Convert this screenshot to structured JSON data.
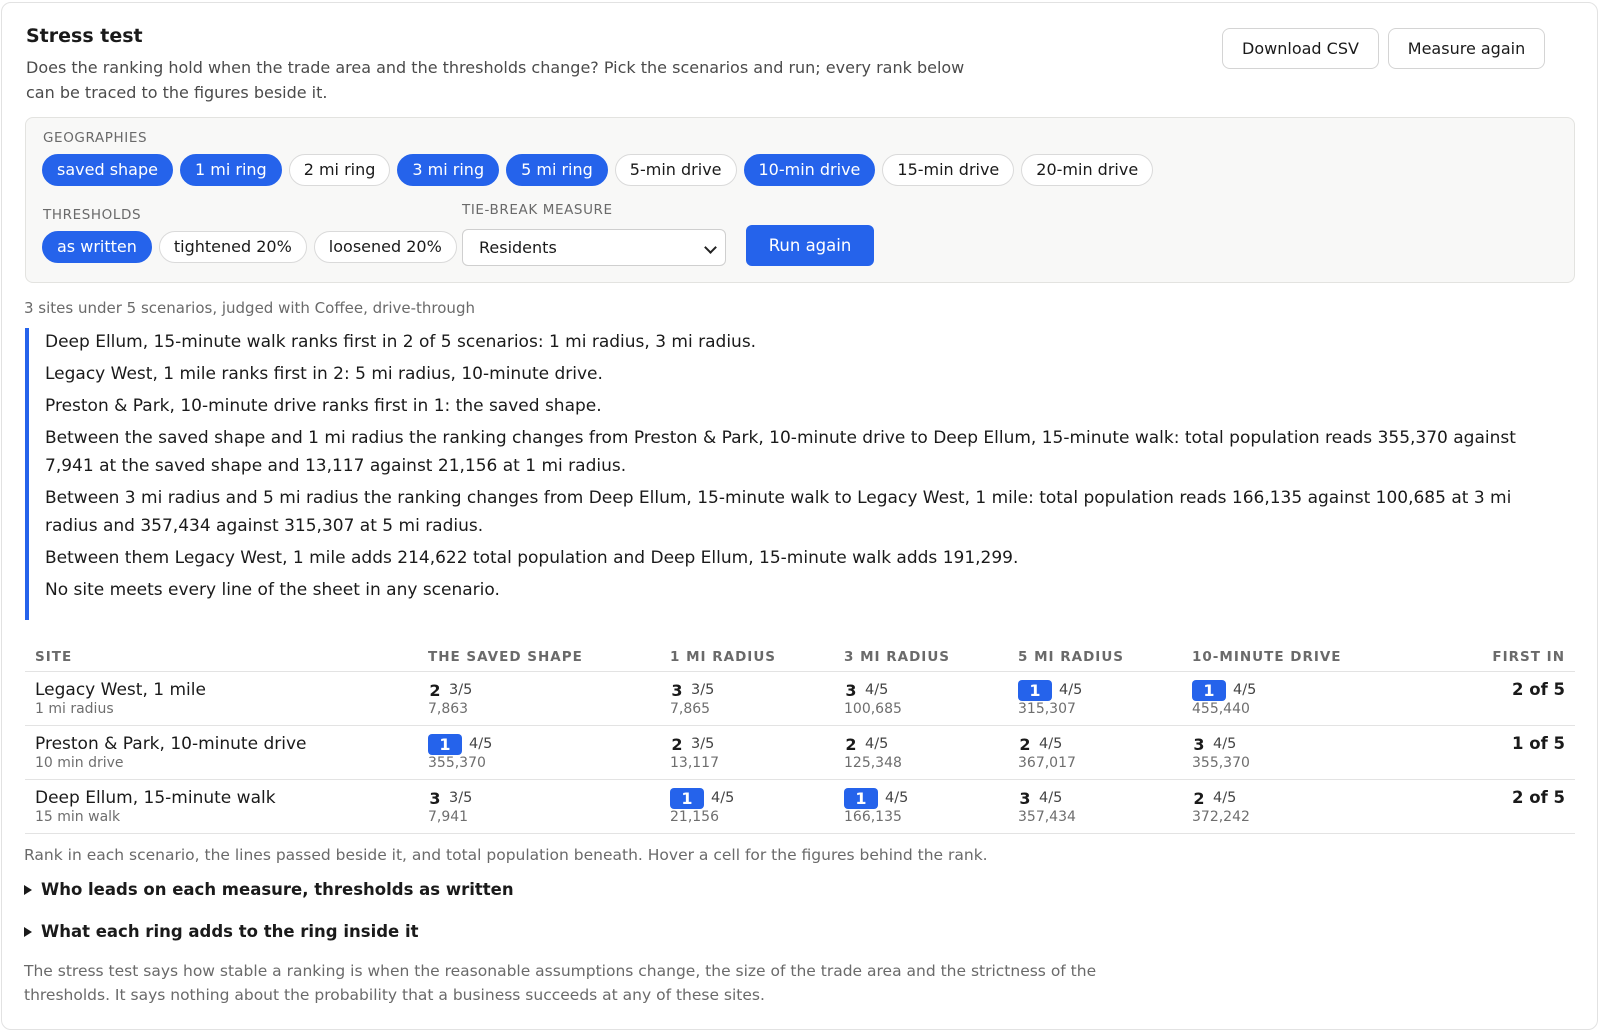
{
  "header": {
    "title": "Stress test",
    "subtitle": "Does the ranking hold when the trade area and the thresholds change? Pick the scenarios and run; every rank below can be traced to the figures beside it.",
    "download_label": "Download CSV",
    "measure_again_label": "Measure again"
  },
  "controls": {
    "geographies_label": "GEOGRAPHIES",
    "geographies": [
      {
        "label": "saved shape",
        "selected": true
      },
      {
        "label": "1 mi ring",
        "selected": true
      },
      {
        "label": "2 mi ring",
        "selected": false
      },
      {
        "label": "3 mi ring",
        "selected": true
      },
      {
        "label": "5 mi ring",
        "selected": true
      },
      {
        "label": "5-min drive",
        "selected": false
      },
      {
        "label": "10-min drive",
        "selected": true
      },
      {
        "label": "15-min drive",
        "selected": false
      },
      {
        "label": "20-min drive",
        "selected": false
      }
    ],
    "thresholds_label": "THRESHOLDS",
    "thresholds": [
      {
        "label": "as written",
        "selected": true
      },
      {
        "label": "tightened 20%",
        "selected": false
      },
      {
        "label": "loosened 20%",
        "selected": false
      }
    ],
    "tiebreak_label": "TIE-BREAK MEASURE",
    "tiebreak_value": "Residents",
    "run_label": "Run again"
  },
  "summary": "3 sites under 5 scenarios, judged with Coffee, drive-through",
  "findings": [
    "Deep Ellum, 15-minute walk ranks first in 2 of 5 scenarios: 1 mi radius, 3 mi radius.",
    "Legacy West, 1 mile ranks first in 2: 5 mi radius, 10-minute drive.",
    "Preston & Park, 10-minute drive ranks first in 1: the saved shape.",
    "Between the saved shape and 1 mi radius the ranking changes from Preston & Park, 10-minute drive to Deep Ellum, 15-minute walk: total population reads 355,370 against 7,941 at the saved shape and 13,117 against 21,156 at 1 mi radius.",
    "Between 3 mi radius and 5 mi radius the ranking changes from Deep Ellum, 15-minute walk to Legacy West, 1 mile: total population reads 166,135 against 100,685 at 3 mi radius and 357,434 against 315,307 at 5 mi radius.",
    "Between them Legacy West, 1 mile adds 214,622 total population and Deep Ellum, 15-minute walk adds 191,299.",
    "No site meets every line of the sheet in any scenario."
  ],
  "table": {
    "columns": [
      "SITE",
      "THE SAVED SHAPE",
      "1 MI RADIUS",
      "3 MI RADIUS",
      "5 MI RADIUS",
      "10-MINUTE DRIVE",
      "FIRST IN"
    ],
    "rows": [
      {
        "site": "Legacy West, 1 mile",
        "sub": "1 mi radius",
        "cells": [
          {
            "rank": "2",
            "passed": "3/5",
            "pop": "7,863"
          },
          {
            "rank": "3",
            "passed": "3/5",
            "pop": "7,865"
          },
          {
            "rank": "3",
            "passed": "4/5",
            "pop": "100,685"
          },
          {
            "rank": "1",
            "passed": "4/5",
            "pop": "315,307"
          },
          {
            "rank": "1",
            "passed": "4/5",
            "pop": "455,440"
          }
        ],
        "first_in": "2 of 5"
      },
      {
        "site": "Preston & Park, 10-minute drive",
        "sub": "10 min drive",
        "cells": [
          {
            "rank": "1",
            "passed": "4/5",
            "pop": "355,370"
          },
          {
            "rank": "2",
            "passed": "3/5",
            "pop": "13,117"
          },
          {
            "rank": "2",
            "passed": "4/5",
            "pop": "125,348"
          },
          {
            "rank": "2",
            "passed": "4/5",
            "pop": "367,017"
          },
          {
            "rank": "3",
            "passed": "4/5",
            "pop": "355,370"
          }
        ],
        "first_in": "1 of 5"
      },
      {
        "site": "Deep Ellum, 15-minute walk",
        "sub": "15 min walk",
        "cells": [
          {
            "rank": "3",
            "passed": "3/5",
            "pop": "7,941"
          },
          {
            "rank": "1",
            "passed": "4/5",
            "pop": "21,156"
          },
          {
            "rank": "1",
            "passed": "4/5",
            "pop": "166,135"
          },
          {
            "rank": "3",
            "passed": "4/5",
            "pop": "357,434"
          },
          {
            "rank": "2",
            "passed": "4/5",
            "pop": "372,242"
          }
        ],
        "first_in": "2 of 5"
      }
    ],
    "caption": "Rank in each scenario, the lines passed beside it, and total population beneath. Hover a cell for the figures behind the rank."
  },
  "disclosures": [
    "Who leads on each measure, thresholds as written",
    "What each ring adds to the ring inside it"
  ],
  "footnote": "The stress test says how stable a ranking is when the reasonable assumptions change, the size of the trade area and the strictness of the thresholds. It says nothing about the probability that a business succeeds at any of these sites.",
  "colors": {
    "accent": "#2563eb"
  }
}
